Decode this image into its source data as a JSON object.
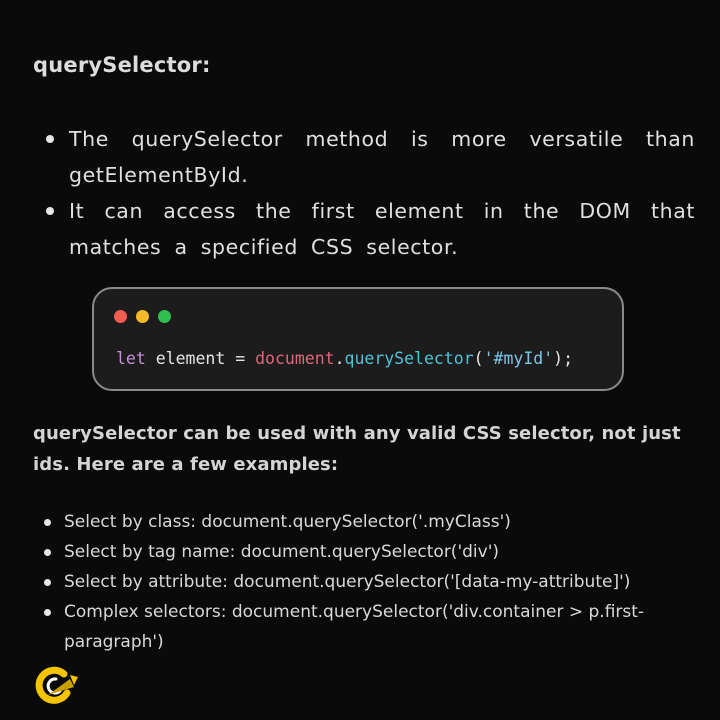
{
  "heading": "querySelector:",
  "intro_points": [
    "The querySelector method is more versatile than getElementById.",
    "It can access the first element in the DOM that matches a specified CSS selector."
  ],
  "code_window": {
    "window_dots": [
      "red",
      "yellow",
      "green"
    ],
    "tokens": {
      "keyword": "let",
      "variable": " element = ",
      "object": "document",
      "dot": ".",
      "method": "querySelector",
      "open_paren": "(",
      "argument": "'#myId'",
      "close": ");"
    },
    "colors": {
      "keyword": "#c78fd8",
      "object": "#e0667a",
      "method": "#4fc3d8",
      "string": "#7cc7e8"
    }
  },
  "summary": "querySelector can be used with any valid CSS selector, not just ids. Here are a few examples:",
  "examples": [
    "Select by class: document.querySelector('.myClass')",
    "Select by tag name: document.querySelector('div')",
    "Select by attribute: document.querySelector('[data-my-attribute]')",
    "Complex selectors: document.querySelector('div.container > p.first-paragraph')"
  ],
  "logo": {
    "icon": "brand-logo-icon",
    "colors": {
      "ring": "#f5c400",
      "arrow": "#c9a000",
      "inner": "#ffffff"
    }
  }
}
